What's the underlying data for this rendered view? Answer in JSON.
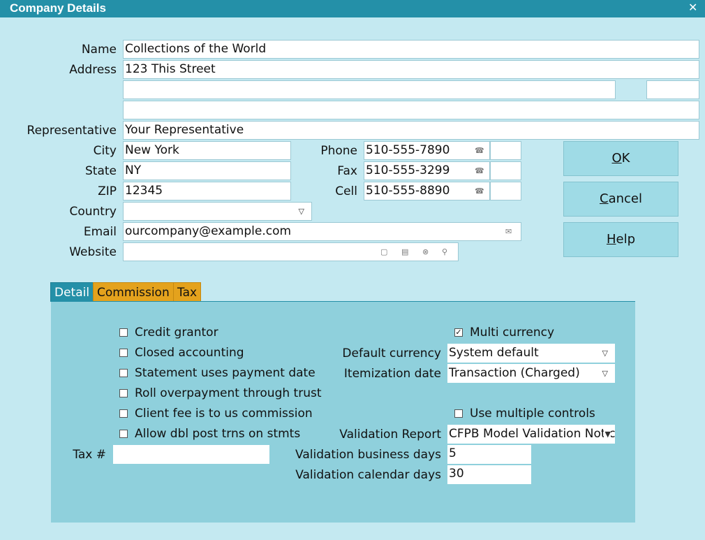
{
  "window": {
    "title": "Company Details",
    "close_glyph": "✕"
  },
  "labels": {
    "name": "Name",
    "address": "Address",
    "representative": "Representative",
    "city": "City",
    "state": "State",
    "zip": "ZIP",
    "country": "Country",
    "email": "Email",
    "website": "Website",
    "phone": "Phone",
    "fax": "Fax",
    "cell": "Cell"
  },
  "fields": {
    "name": "Collections of the World",
    "address1": "123 This Street",
    "address2": "",
    "address2b": "",
    "address3": "",
    "representative": "Your Representative",
    "city": "New York",
    "state": "NY",
    "zip": "12345",
    "country": "",
    "email": "ourcompany@example.com",
    "website": "",
    "phone": "510-555-7890",
    "phone_ext": "",
    "fax": "510-555-3299",
    "fax_ext": "",
    "cell": "510-555-8890",
    "cell_ext": ""
  },
  "icons": {
    "phone": "phone-icon",
    "dropdown": "chevron-down-icon",
    "email": "envelope-icon",
    "folder": "folder-icon",
    "print": "printer-icon",
    "clear": "clear-icon",
    "search": "search-icon"
  },
  "buttons": {
    "ok": {
      "mnemonic": "O",
      "rest": "K"
    },
    "cancel": {
      "mnemonic": "C",
      "rest": "ancel"
    },
    "help": {
      "mnemonic": "H",
      "rest": "elp"
    }
  },
  "tabs": [
    {
      "label": "Detail",
      "active": true
    },
    {
      "label": "Commission",
      "active": false
    },
    {
      "label": "Tax",
      "active": false
    }
  ],
  "detail": {
    "checkboxes": [
      {
        "label": "Credit grantor",
        "checked": false
      },
      {
        "label": "Closed accounting",
        "checked": false
      },
      {
        "label": "Statement uses payment date",
        "checked": false
      },
      {
        "label": "Roll overpayment through trust",
        "checked": false
      },
      {
        "label": "Client fee is to us commission",
        "checked": false
      },
      {
        "label": "Allow dbl post trns on stmts",
        "checked": false
      }
    ],
    "multi_currency": {
      "label": "Multi currency",
      "checked": true
    },
    "use_multiple_controls": {
      "label": "Use multiple controls",
      "checked": false
    },
    "default_currency": {
      "label": "Default currency",
      "value": "System default"
    },
    "itemization_date": {
      "label": "Itemization date",
      "value": "Transaction (Charged)"
    },
    "validation_report": {
      "label": "Validation Report",
      "value": "CFPB Model Validation Notice"
    },
    "validation_business_days": {
      "label": "Validation business days",
      "value": "5"
    },
    "validation_calendar_days": {
      "label": "Validation calendar days",
      "value": "30"
    },
    "tax": {
      "label": "Tax #",
      "value": ""
    }
  },
  "colors": {
    "title_bar": "#2490a8",
    "background": "#c4e9f1",
    "panel": "#8fd0dc",
    "tab_inactive": "#e4a21d",
    "button": "#9fdbe6"
  }
}
